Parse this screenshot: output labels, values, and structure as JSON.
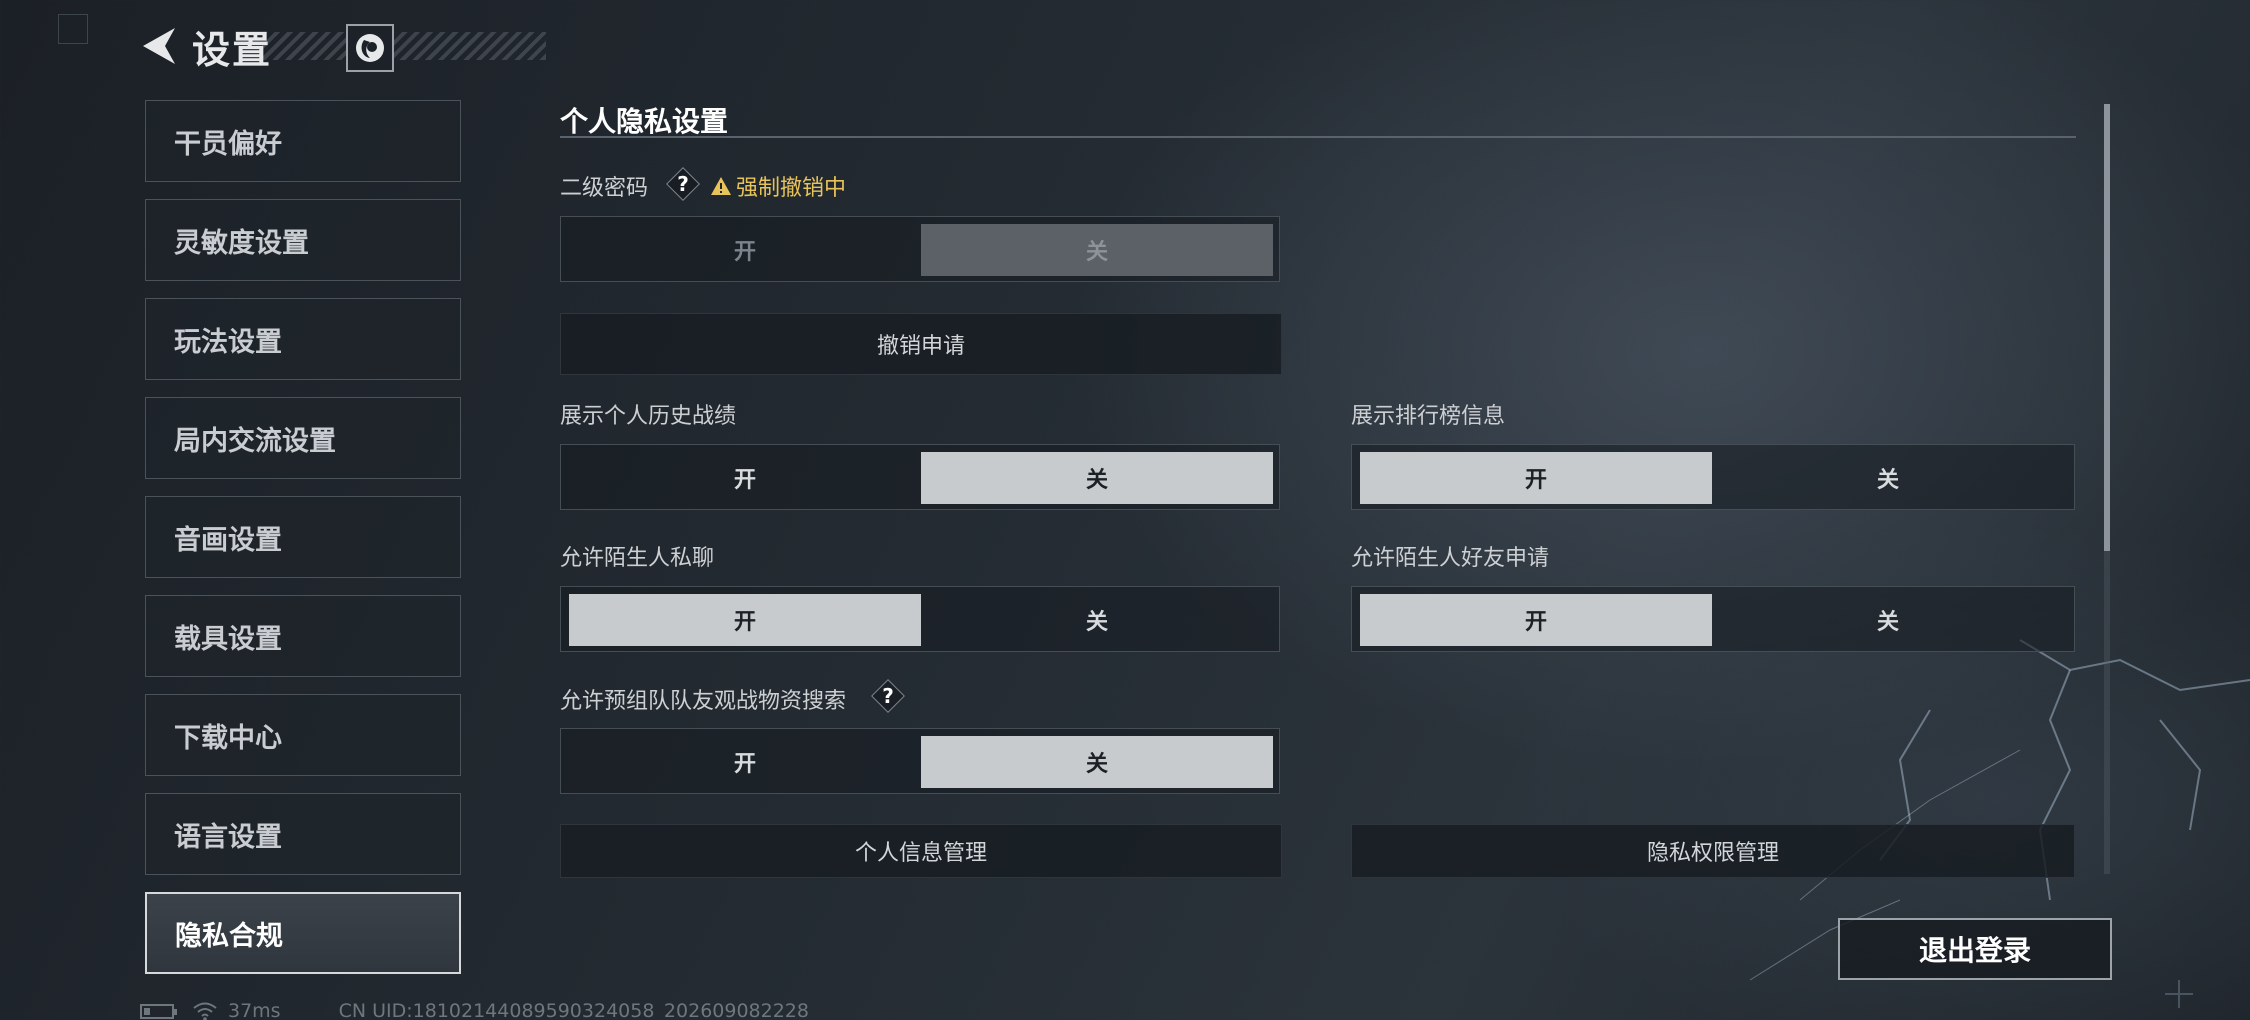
{
  "header": {
    "title": "设置"
  },
  "sidebar": {
    "items": [
      {
        "label": "干员偏好",
        "active": false
      },
      {
        "label": "灵敏度设置",
        "active": false
      },
      {
        "label": "玩法设置",
        "active": false
      },
      {
        "label": "局内交流设置",
        "active": false
      },
      {
        "label": "音画设置",
        "active": false
      },
      {
        "label": "载具设置",
        "active": false
      },
      {
        "label": "下载中心",
        "active": false
      },
      {
        "label": "语言设置",
        "active": false
      },
      {
        "label": "隐私合规",
        "active": true
      }
    ]
  },
  "main": {
    "section_title": "个人隐私设置",
    "secondary_password": {
      "label": "二级密码",
      "help": "?",
      "warning": "强制撤销中",
      "on_label": "开",
      "off_label": "关",
      "selected": "off",
      "disabled": true
    },
    "revoke_button": "撤销申请",
    "show_history": {
      "label": "展示个人历史战绩",
      "on_label": "开",
      "off_label": "关",
      "selected": "off"
    },
    "show_leaderboard": {
      "label": "展示排行榜信息",
      "on_label": "开",
      "off_label": "关",
      "selected": "on"
    },
    "stranger_chat": {
      "label": "允许陌生人私聊",
      "on_label": "开",
      "off_label": "关",
      "selected": "on"
    },
    "stranger_friend": {
      "label": "允许陌生人好友申请",
      "on_label": "开",
      "off_label": "关",
      "selected": "on"
    },
    "team_spectate": {
      "label": "允许预组队队友观战物资搜索",
      "help": "?",
      "on_label": "开",
      "off_label": "关",
      "selected": "off"
    },
    "personal_info_button": "个人信息管理",
    "privacy_permission_button": "隐私权限管理",
    "scroll_fraction": 0.58
  },
  "logout_button": "退出登录",
  "status_bar": {
    "ping": "37ms",
    "uid": "CN UID:18102144089590324058_202609082228"
  },
  "colors": {
    "warning": "#e8c35a",
    "toggle_on": "#c8cbce",
    "background": "#232a31"
  }
}
